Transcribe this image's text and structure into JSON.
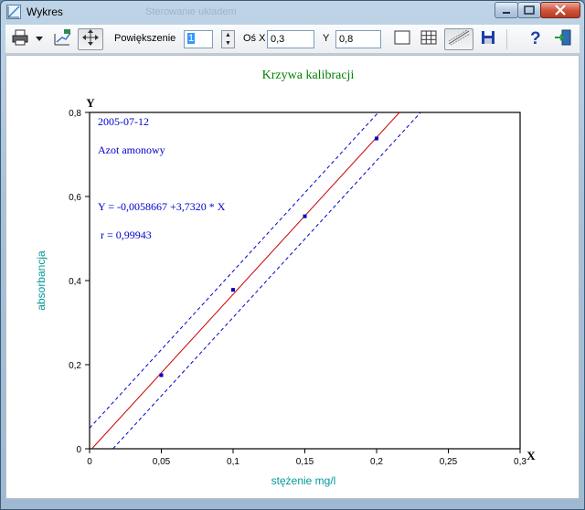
{
  "window": {
    "title": "Wykres",
    "background_title": "Sterowanie ukladem",
    "accent": "#3c5a78"
  },
  "toolbar": {
    "zoom_label": "Powiększenie",
    "zoom_value": "1",
    "axis_x_label": "Oś X",
    "axis_x_value": "0,3",
    "axis_y_label": "Y",
    "axis_y_value": "0,8",
    "icons": [
      "printer-icon",
      "dropdown-arrow-icon",
      "chart-edit-icon",
      "move-arrows-icon",
      "frame-icon",
      "grid-icon",
      "regression-lines-icon",
      "save-icon",
      "help-icon",
      "exit-icon"
    ]
  },
  "chart": {
    "title": "Krzywa kalibracji",
    "title_color": "#008000",
    "text_color": "#0000cc",
    "date": "2005-07-12",
    "analyte": "Azot amonowy",
    "equation": "Y = -0,0058667 +3,7320 * X",
    "correlation": "r = 0,99943",
    "xlabel": "stężenie mg/l",
    "ylabel": "absorbancja",
    "x_axis_letter": "X",
    "y_axis_letter": "Y",
    "axis_label_color": "#009999",
    "regression_color": "#cc0000",
    "confidence_color": "#0000cc"
  },
  "chart_data": {
    "type": "scatter",
    "title": "Krzywa kalibracji",
    "xlabel": "stężenie mg/l",
    "ylabel": "absorbancja",
    "xlim": [
      0,
      0.3
    ],
    "ylim": [
      0,
      0.8
    ],
    "x_ticks": [
      "0",
      "0,05",
      "0,1",
      "0,15",
      "0,2",
      "0,25",
      "0,3"
    ],
    "y_ticks": [
      "0",
      "0,2",
      "0,4",
      "0,6",
      "0,8"
    ],
    "points": [
      {
        "x": 0.05,
        "y": 0.175
      },
      {
        "x": 0.1,
        "y": 0.378
      },
      {
        "x": 0.15,
        "y": 0.553
      },
      {
        "x": 0.2,
        "y": 0.738
      }
    ],
    "regression": {
      "intercept": -0.0058667,
      "slope": 3.732
    },
    "confidence_offset": 0.055,
    "grid": false
  }
}
